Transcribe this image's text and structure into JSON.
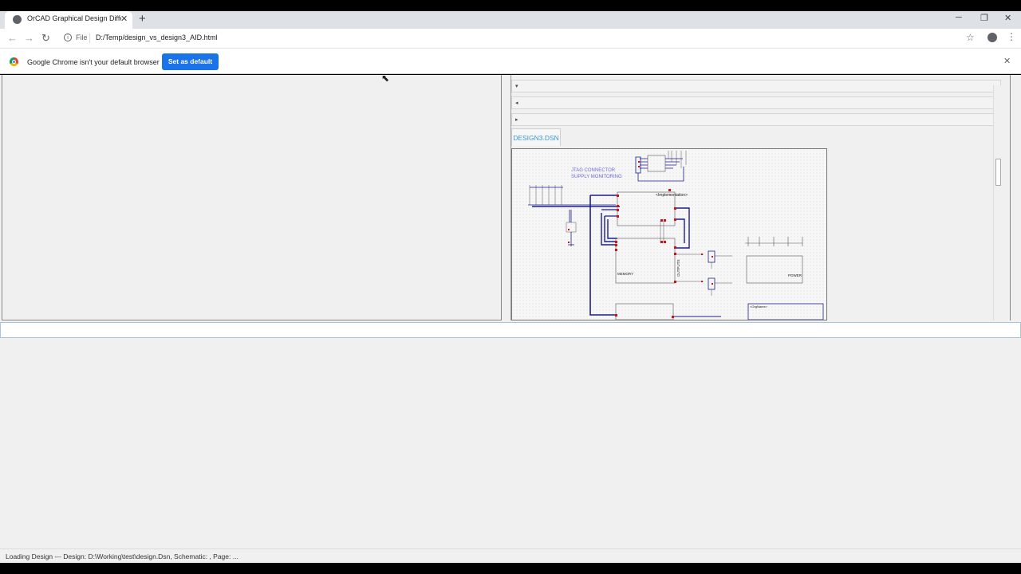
{
  "browser": {
    "tab_title": "OrCAD Graphical Design Difference",
    "tab_close": "✕",
    "new_tab": "+",
    "window_controls": {
      "minimize": "─",
      "restore": "❐",
      "close": "✕"
    },
    "nav": {
      "back": "←",
      "forward": "→",
      "reload": "↻"
    },
    "url_scheme": "File",
    "url": "D:/Temp/design_vs_design3_AID.html",
    "info_glyph": "i",
    "star": "☆",
    "menu": "⋮"
  },
  "infobar": {
    "message": "Google Chrome isn't your default browser",
    "button": "Set as default",
    "close": "✕"
  },
  "right_pane": {
    "rows": [
      "▾",
      "◂",
      "▸"
    ],
    "doc_tab": "DESIGN3.DSN"
  },
  "schematic": {
    "title_lines": [
      "JTAG CONNECTOR",
      "SUPPLY MONITORING"
    ],
    "labels": {
      "implementation": "<Implementation>",
      "memory": "MEMORY",
      "outputs": "OUTPUTS",
      "power": "POWER",
      "orgname": "<OrgName>"
    },
    "colors": {
      "wire": "#1d1d8c",
      "pin": "#c4161c",
      "part": "#555555",
      "text": "#6a6ad8"
    }
  },
  "status": "Loading Design --- Design: D:\\Working\\test\\design.Dsn, Schematic: , Page: ...",
  "cursor_glyph": "⬉"
}
